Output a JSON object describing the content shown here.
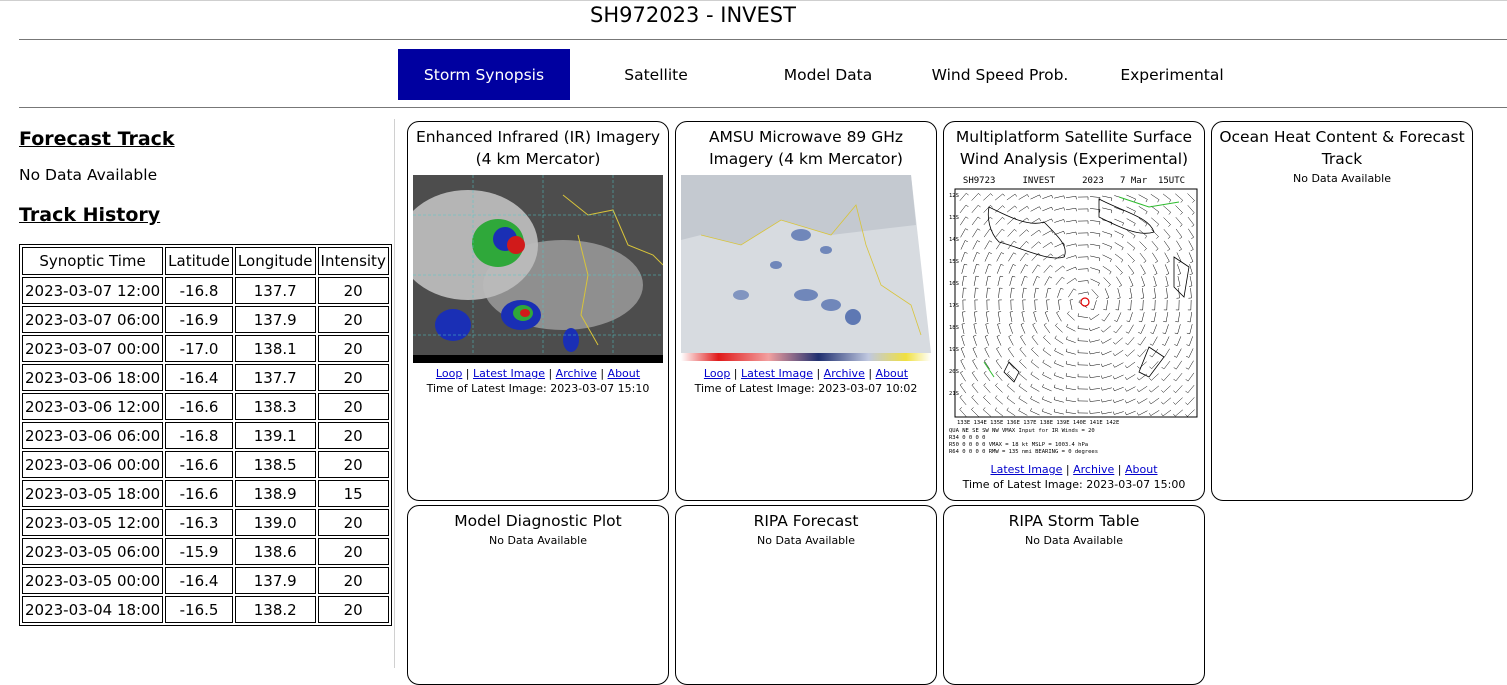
{
  "title": "SH972023 - INVEST",
  "nav": [
    {
      "label": "Storm Synopsis",
      "active": true
    },
    {
      "label": "Satellite"
    },
    {
      "label": "Model Data"
    },
    {
      "label": "Wind Speed Prob."
    },
    {
      "label": "Experimental"
    }
  ],
  "left": {
    "forecast_heading": "Forecast Track",
    "forecast_nodata": "No Data Available",
    "history_heading": "Track History",
    "columns": [
      "Synoptic Time",
      "Latitude",
      "Longitude",
      "Intensity"
    ],
    "rows": [
      [
        "2023-03-07 12:00",
        "-16.8",
        "137.7",
        "20"
      ],
      [
        "2023-03-07 06:00",
        "-16.9",
        "137.9",
        "20"
      ],
      [
        "2023-03-07 00:00",
        "-17.0",
        "138.1",
        "20"
      ],
      [
        "2023-03-06 18:00",
        "-16.4",
        "137.7",
        "20"
      ],
      [
        "2023-03-06 12:00",
        "-16.6",
        "138.3",
        "20"
      ],
      [
        "2023-03-06 06:00",
        "-16.8",
        "139.1",
        "20"
      ],
      [
        "2023-03-06 00:00",
        "-16.6",
        "138.5",
        "20"
      ],
      [
        "2023-03-05 18:00",
        "-16.6",
        "138.9",
        "15"
      ],
      [
        "2023-03-05 12:00",
        "-16.3",
        "139.0",
        "20"
      ],
      [
        "2023-03-05 06:00",
        "-15.9",
        "138.6",
        "20"
      ],
      [
        "2023-03-05 00:00",
        "-16.4",
        "137.9",
        "20"
      ],
      [
        "2023-03-04 18:00",
        "-16.5",
        "138.2",
        "20"
      ]
    ]
  },
  "cards": {
    "ir": {
      "title": "Enhanced Infrared (IR) Imagery (4 km Mercator)",
      "links": [
        "Loop",
        "Latest Image",
        "Archive",
        "About"
      ],
      "time": "Time of Latest Image: 2023-03-07 15:10"
    },
    "amsu": {
      "title": "AMSU Microwave 89 GHz Imagery (4 km Mercator)",
      "links": [
        "Loop",
        "Latest Image",
        "Archive",
        "About"
      ],
      "time": "Time of Latest Image: 2023-03-07 10:02"
    },
    "wind": {
      "title": "Multiplatform Satellite Surface Wind Analysis (Experimental)",
      "chart_header": "SH9723     INVEST     2023   7 Mar  15UTC",
      "links": [
        "Latest Image",
        "Archive",
        "About"
      ],
      "time": "Time of Latest Image: 2023-03-07 15:00"
    },
    "ohc": {
      "title": "Ocean Heat Content & Forecast Track",
      "nodata": "No Data Available"
    },
    "diag": {
      "title": "Model Diagnostic Plot",
      "nodata": "No Data Available"
    },
    "ripa_fc": {
      "title": "RIPA Forecast",
      "nodata": "No Data Available"
    },
    "ripa_tab": {
      "title": "RIPA Storm Table",
      "nodata": "No Data Available"
    }
  },
  "colors": {
    "nav_active_bg": "#0000a0",
    "link": "#0000cc"
  }
}
